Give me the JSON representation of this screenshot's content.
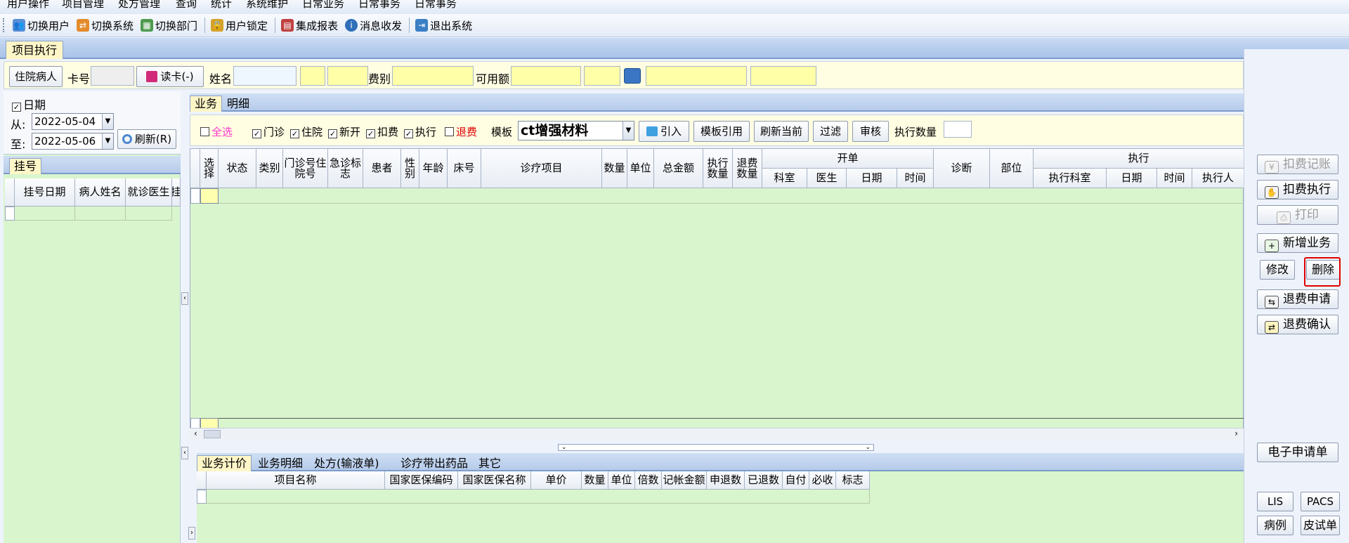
{
  "menu": [
    "用户操作",
    "项目管理",
    "处方管理",
    "查询",
    "统计",
    "系统维护",
    "日常业务",
    "日常事务",
    "日常事务"
  ],
  "toolbar": [
    {
      "label": "切换用户",
      "icon": "switch-user-icon",
      "color": "#5a8fd6"
    },
    {
      "label": "切换系统",
      "icon": "switch-system-icon",
      "color": "#e38b2c"
    },
    {
      "label": "切换部门",
      "icon": "switch-department-icon",
      "color": "#4e9a4e"
    },
    {
      "label": "用户锁定",
      "icon": "user-lock-icon",
      "color": "#d4a12a"
    },
    {
      "label": "集成报表",
      "icon": "report-icon",
      "color": "#c04040"
    },
    {
      "label": "消息收发",
      "icon": "message-icon",
      "color": "#2f6fb8"
    },
    {
      "label": "退出系统",
      "icon": "exit-icon",
      "color": "#3a7fc4"
    }
  ],
  "main_tab": "项目执行",
  "info": {
    "patient_type": "住院病人",
    "card_label": "卡号",
    "read_card": "读卡(-)",
    "name_label": "姓名",
    "fee_type_label": "费别",
    "available_label": "可用额"
  },
  "left": {
    "date_label": "日期",
    "from_label": "从:",
    "to_label": "至:",
    "from_date": "2022-05-04",
    "to_date": "2022-05-06",
    "refresh": "刷新(R)",
    "tab": "挂号",
    "columns": [
      "挂号日期",
      "病人姓名",
      "就诊医生",
      "挂"
    ]
  },
  "center_tabs": [
    "业务",
    "明细"
  ],
  "filters": {
    "select_all": "全选",
    "checks": [
      "门诊",
      "住院",
      "新开",
      "扣费",
      "执行"
    ],
    "refund": "退费",
    "template_label": "模板",
    "template_value": "ct增强材料",
    "import": "引入",
    "template_ref": "模板引用",
    "refresh_current": "刷新当前",
    "filter": "过滤",
    "review": "审核",
    "exec_qty_label": "执行数量"
  },
  "grid": {
    "columns": [
      "选择",
      "状态",
      "类别",
      "门诊号住院号",
      "急诊标志",
      "患者",
      "性别",
      "年龄",
      "床号",
      "诊疗项目",
      "数量",
      "单位",
      "总金额",
      "执行数量",
      "退费数量",
      "科室",
      "医生",
      "日期",
      "时间",
      "诊断",
      "部位",
      "执行科室",
      "日期",
      "时间",
      "执行人"
    ],
    "group_open": "开单",
    "group_exec": "执行"
  },
  "bottom_tabs": [
    "业务计价",
    "业务明细",
    "处方(输液单)",
    "诊疗带出药品",
    "其它"
  ],
  "bottom_columns": [
    "项目名称",
    "国家医保编码",
    "国家医保名称",
    "单价",
    "数量",
    "单位",
    "倍数",
    "记帐金额",
    "申退数",
    "已退数",
    "自付",
    "必收",
    "标志"
  ],
  "right_buttons": {
    "deduct_record": "扣费记账",
    "deduct_exec": "扣费执行",
    "print": "打印",
    "new_business": "新增业务",
    "modify": "修改",
    "delete": "删除",
    "refund_apply": "退费申请",
    "refund_confirm": "退费确认",
    "e_request": "电子申请单",
    "lis": "LIS",
    "pacs": "PACS",
    "case": "病例",
    "skin_test": "皮试单"
  }
}
